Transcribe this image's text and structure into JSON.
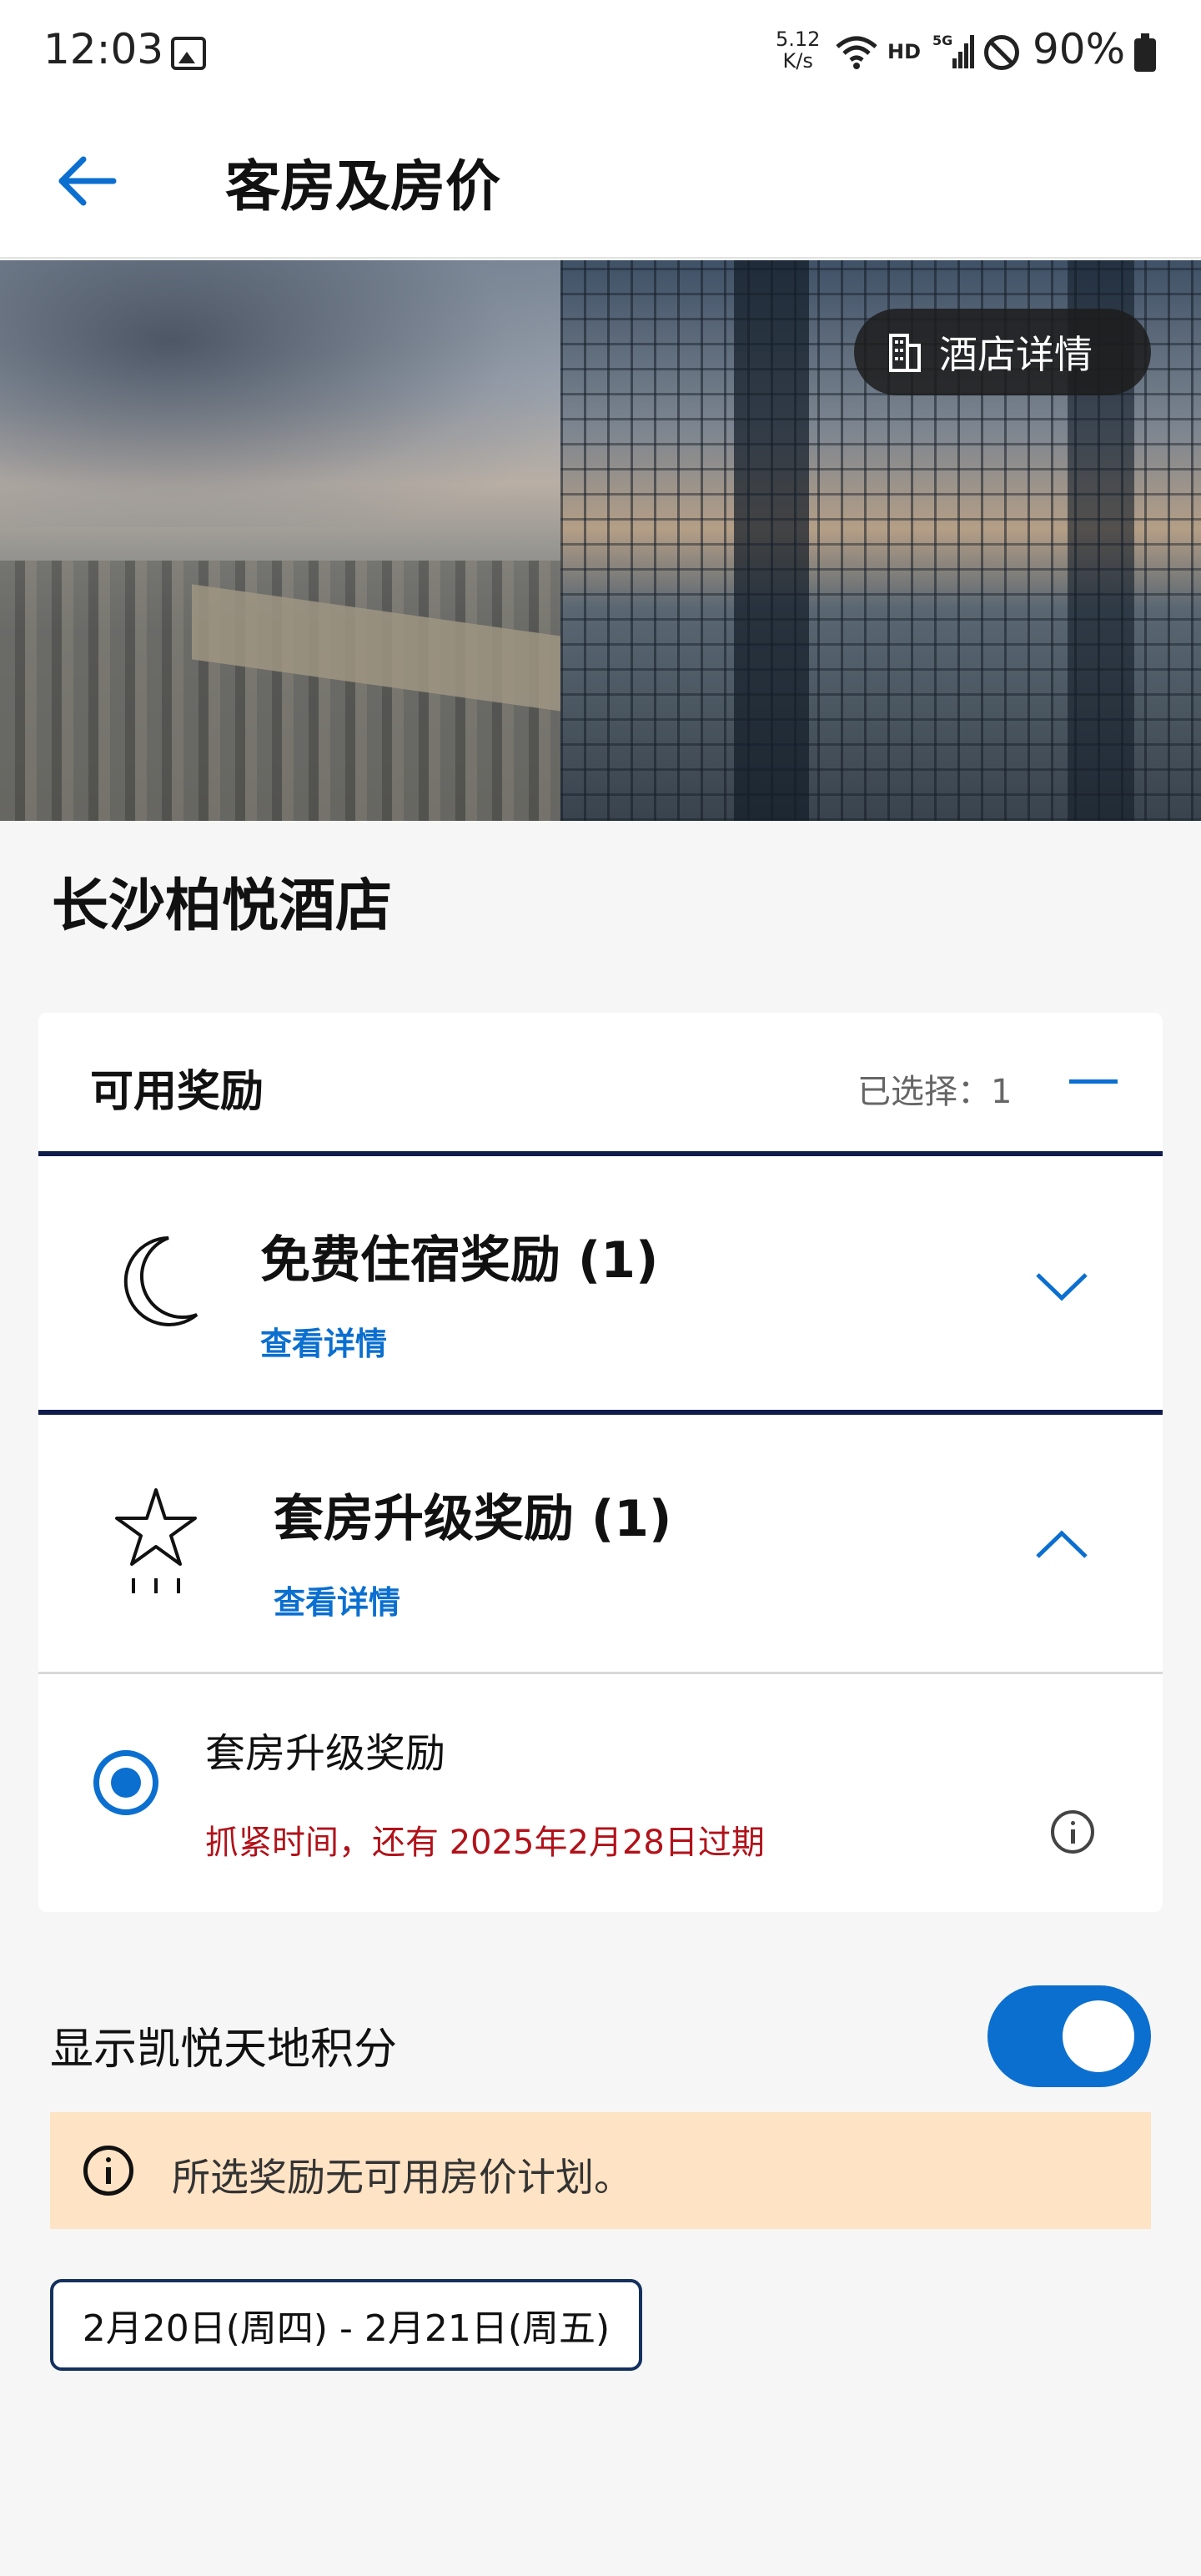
{
  "status_bar": {
    "time": "12:03",
    "speed_value": "5.12",
    "speed_unit": "K/s",
    "hd": "HD",
    "network": "5G",
    "battery": "90%"
  },
  "app_bar": {
    "title": "客房及房价"
  },
  "hero": {
    "hotel_details_button": "酒店详情"
  },
  "hotel": {
    "name": "长沙柏悦酒店"
  },
  "rewards": {
    "header_title": "可用奖励",
    "selected_label": "已选择：1",
    "items": [
      {
        "title": "免费住宿奖励 (1)",
        "link": "查看详情",
        "icon": "moon-icon",
        "expanded": false
      },
      {
        "title": "套房升级奖励 (1)",
        "link": "查看详情",
        "icon": "star-icon",
        "expanded": true,
        "options": [
          {
            "label": "套房升级奖励",
            "expiry": "抓紧时间，还有 2025年2月28日过期",
            "selected": true
          }
        ]
      }
    ]
  },
  "points_toggle": {
    "label": "显示凯悦天地积分",
    "on": true
  },
  "notice": {
    "text": "所选奖励无可用房价计划。"
  },
  "dates": {
    "range": "2月20日(周四) - 2月21日(周五)"
  },
  "colors": {
    "accent": "#0b6fd0",
    "navy_rule": "#101d4b",
    "expiry_red": "#b1121a",
    "notice_bg": "#fee3c4"
  }
}
